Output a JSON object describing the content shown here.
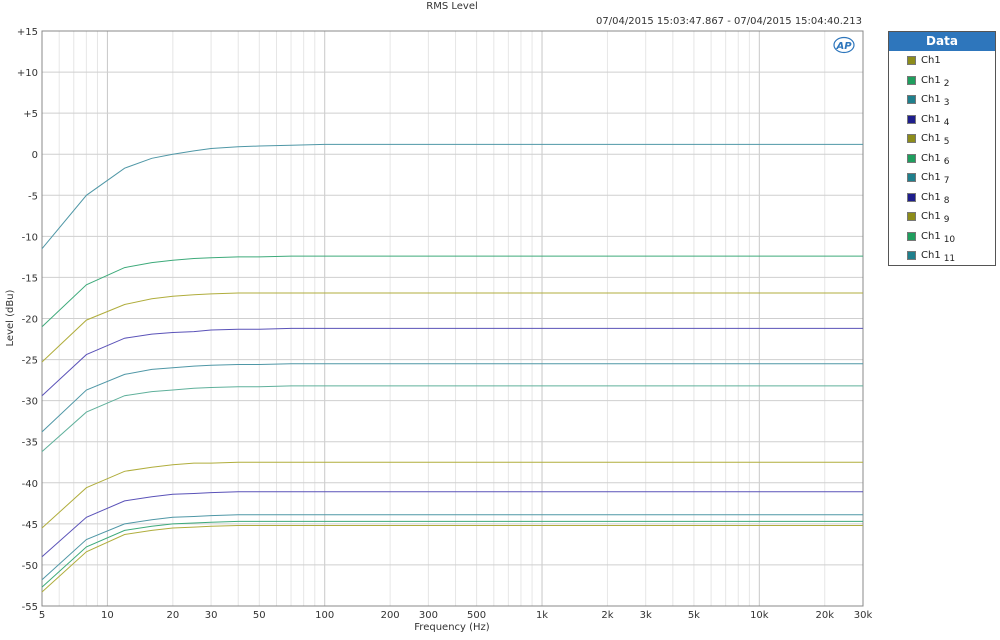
{
  "chart_data": {
    "type": "line",
    "title": "RMS Level",
    "subtitle": "07/04/2015 15:03:47.867 - 07/04/2015 15:04:40.213",
    "xlabel": "Frequency (Hz)",
    "ylabel": "Level (dBu)",
    "xscale": "log",
    "xlim": [
      5,
      30000
    ],
    "ylim": [
      -55,
      15
    ],
    "grid": true,
    "x_ticks": [
      {
        "v": 5,
        "label": "5"
      },
      {
        "v": 10,
        "label": "10"
      },
      {
        "v": 20,
        "label": "20"
      },
      {
        "v": 30,
        "label": "30"
      },
      {
        "v": 50,
        "label": "50"
      },
      {
        "v": 100,
        "label": "100"
      },
      {
        "v": 200,
        "label": "200"
      },
      {
        "v": 300,
        "label": "300"
      },
      {
        "v": 500,
        "label": "500"
      },
      {
        "v": 1000,
        "label": "1k"
      },
      {
        "v": 2000,
        "label": "2k"
      },
      {
        "v": 3000,
        "label": "3k"
      },
      {
        "v": 5000,
        "label": "5k"
      },
      {
        "v": 10000,
        "label": "10k"
      },
      {
        "v": 20000,
        "label": "20k"
      },
      {
        "v": 30000,
        "label": "30k"
      }
    ],
    "y_ticks": [
      {
        "v": 15,
        "label": "+15"
      },
      {
        "v": 10,
        "label": "+10"
      },
      {
        "v": 5,
        "label": "+5"
      },
      {
        "v": 0,
        "label": "0"
      },
      {
        "v": -5,
        "label": "-5"
      },
      {
        "v": -10,
        "label": "-10"
      },
      {
        "v": -15,
        "label": "-15"
      },
      {
        "v": -20,
        "label": "-20"
      },
      {
        "v": -25,
        "label": "-25"
      },
      {
        "v": -30,
        "label": "-30"
      },
      {
        "v": -35,
        "label": "-35"
      },
      {
        "v": -40,
        "label": "-40"
      },
      {
        "v": -45,
        "label": "-45"
      },
      {
        "v": -50,
        "label": "-50"
      },
      {
        "v": -55,
        "label": "-55"
      }
    ],
    "x": [
      5,
      8,
      12,
      16,
      20,
      25,
      30,
      40,
      50,
      70,
      100,
      1000,
      10000,
      30000
    ],
    "series": [
      {
        "name": "Ch1",
        "color": "#4f97a6",
        "values": [
          -11.5,
          -5.0,
          -1.7,
          -0.5,
          0.0,
          0.4,
          0.7,
          0.9,
          1.0,
          1.1,
          1.2,
          1.2,
          1.2,
          1.2
        ]
      },
      {
        "name": "Ch1",
        "color": "#3daa7a",
        "values": [
          -21.0,
          -15.9,
          -13.8,
          -13.2,
          -12.9,
          -12.7,
          -12.6,
          -12.5,
          -12.5,
          -12.4,
          -12.4,
          -12.4,
          -12.4,
          -12.4
        ]
      },
      {
        "name": "Ch1",
        "color": "#b0ad3c",
        "values": [
          -25.3,
          -20.2,
          -18.3,
          -17.6,
          -17.3,
          -17.1,
          -17.0,
          -16.9,
          -16.9,
          -16.9,
          -16.9,
          -16.9,
          -16.9,
          -16.9
        ]
      },
      {
        "name": "Ch1",
        "color": "#5a52b8",
        "values": [
          -29.4,
          -24.4,
          -22.4,
          -21.9,
          -21.7,
          -21.6,
          -21.4,
          -21.3,
          -21.3,
          -21.2,
          -21.2,
          -21.2,
          -21.2,
          -21.2
        ]
      },
      {
        "name": "Ch1",
        "color": "#4f97a6",
        "values": [
          -33.8,
          -28.7,
          -26.8,
          -26.2,
          -26.0,
          -25.8,
          -25.7,
          -25.6,
          -25.6,
          -25.5,
          -25.5,
          -25.5,
          -25.5,
          -25.5
        ]
      },
      {
        "name": "Ch1",
        "color": "#5fb09b",
        "values": [
          -36.2,
          -31.4,
          -29.4,
          -28.9,
          -28.7,
          -28.5,
          -28.4,
          -28.3,
          -28.3,
          -28.2,
          -28.2,
          -28.2,
          -28.2,
          -28.2
        ]
      },
      {
        "name": "Ch1",
        "color": "#b0ad3c",
        "values": [
          -45.5,
          -40.6,
          -38.6,
          -38.1,
          -37.8,
          -37.6,
          -37.6,
          -37.5,
          -37.5,
          -37.5,
          -37.5,
          -37.5,
          -37.5,
          -37.5
        ]
      },
      {
        "name": "Ch1",
        "color": "#5a52b8",
        "values": [
          -49.0,
          -44.2,
          -42.2,
          -41.7,
          -41.4,
          -41.3,
          -41.2,
          -41.1,
          -41.1,
          -41.1,
          -41.1,
          -41.1,
          -41.1,
          -41.1
        ]
      },
      {
        "name": "Ch1",
        "color": "#4f97a6",
        "values": [
          -51.8,
          -46.9,
          -45.0,
          -44.5,
          -44.2,
          -44.1,
          -44.0,
          -43.9,
          -43.9,
          -43.9,
          -43.9,
          -43.9,
          -43.9,
          -43.9
        ]
      },
      {
        "name": "Ch1",
        "color": "#3daa7a",
        "values": [
          -52.7,
          -47.8,
          -45.8,
          -45.3,
          -45.0,
          -44.9,
          -44.8,
          -44.7,
          -44.7,
          -44.7,
          -44.7,
          -44.7,
          -44.7,
          -44.7
        ]
      },
      {
        "name": "Ch1",
        "color": "#b0ad3c",
        "values": [
          -53.3,
          -48.4,
          -46.3,
          -45.8,
          -45.5,
          -45.4,
          -45.3,
          -45.2,
          -45.2,
          -45.2,
          -45.2,
          -45.2,
          -45.2,
          -45.2
        ]
      }
    ]
  },
  "legend": {
    "title": "Data",
    "items": [
      {
        "label": "Ch1",
        "sub": "",
        "swatch": "#8c8c1a"
      },
      {
        "label": "Ch1",
        "sub": "2",
        "swatch": "#1f9e5e"
      },
      {
        "label": "Ch1",
        "sub": "3",
        "swatch": "#1f7f8c"
      },
      {
        "label": "Ch1",
        "sub": "4",
        "swatch": "#1e1e8c"
      },
      {
        "label": "Ch1",
        "sub": "5",
        "swatch": "#8c8c1a"
      },
      {
        "label": "Ch1",
        "sub": "6",
        "swatch": "#1f9e5e"
      },
      {
        "label": "Ch1",
        "sub": "7",
        "swatch": "#1f7f8c"
      },
      {
        "label": "Ch1",
        "sub": "8",
        "swatch": "#1e1e8c"
      },
      {
        "label": "Ch1",
        "sub": "9",
        "swatch": "#8c8c1a"
      },
      {
        "label": "Ch1",
        "sub": "10",
        "swatch": "#1f9e5e"
      },
      {
        "label": "Ch1",
        "sub": "11",
        "swatch": "#1f7f8c"
      }
    ]
  },
  "logo": {
    "text": "AP",
    "color": "#2e76bc"
  }
}
